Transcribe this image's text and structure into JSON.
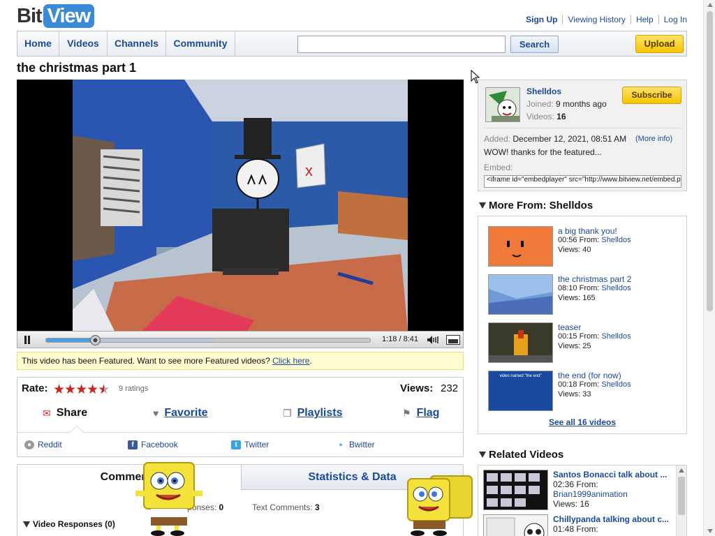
{
  "logo": {
    "part1": "Bit",
    "part2": "View"
  },
  "toplinks": [
    "Sign Up",
    "Viewing History",
    "Help",
    "Log In"
  ],
  "nav": {
    "items": [
      "Home",
      "Videos",
      "Channels",
      "Community"
    ],
    "search_value": "",
    "search_button": "Search",
    "upload_button": "Upload"
  },
  "video": {
    "title": "the christmas part 1",
    "time": "1:18 / 8:41",
    "progress_fraction": 0.15,
    "buffered_fraction": 0.52
  },
  "featured": {
    "text": "This video has been Featured. Want to see more Featured videos?",
    "link": "Click here",
    "end": "."
  },
  "rating": {
    "label": "Rate:",
    "stars": 4.5,
    "count_text": "9 ratings",
    "views_label": "Views:",
    "views": "232"
  },
  "actions": {
    "share": "Share",
    "favorite": "Favorite",
    "playlists": "Playlists",
    "flag": "Flag"
  },
  "social": {
    "reddit": "Reddit",
    "facebook": "Facebook",
    "twitter": "Twitter",
    "bwitter": "Bwitter"
  },
  "tabs": {
    "comments": "Comments",
    "stats": "Statistics & Data",
    "responses_label": "Video Responses:",
    "responses_count": "0",
    "text_comments_label": "Text Comments:",
    "text_comments_count": "3",
    "video_responses_heading": "Video Responses (0)"
  },
  "channel": {
    "name": "Shelldos",
    "joined_label": "Joined:",
    "joined": "9 months ago",
    "videos_label": "Videos:",
    "videos": "16",
    "subscribe": "Subscribe",
    "added_label": "Added:",
    "added": "December 12, 2021, 08:51 AM",
    "more_info": "(More info)",
    "description": "WOW! thanks for the featured...",
    "embed_label": "Embed:",
    "embed_code": "<iframe id=\"embedplayer\" src=\"http://www.bitview.net/embed.php"
  },
  "more_from": {
    "heading": "More From: Shelldos",
    "from_label": "From:",
    "views_label": "Views:",
    "videos": [
      {
        "title": "a big thank you!",
        "duration": "00:56",
        "user": "Shelldos",
        "views": "40"
      },
      {
        "title": "the christmas part 2",
        "duration": "08:10",
        "user": "Shelldos",
        "views": "165"
      },
      {
        "title": "teaser",
        "duration": "00:15",
        "user": "Shelldos",
        "views": "25"
      },
      {
        "title": "the end (for now)",
        "duration": "00:18",
        "user": "Shelldos",
        "views": "33"
      }
    ],
    "see_all": "See all 16 videos",
    "thumb4_text": "video named \"the end\""
  },
  "related": {
    "heading": "Related Videos",
    "from_label": "From:",
    "views_label": "Views:",
    "videos": [
      {
        "title": "Santos Bonacci talk about ...",
        "duration": "02:36",
        "user": "Brian1999animation",
        "views": "16"
      },
      {
        "title": "Chillypanda talking about c...",
        "duration": "01:48",
        "user": "",
        "views": ""
      }
    ]
  },
  "colors": {
    "link": "#1a4a9a",
    "star": "#d42020",
    "button_yellow": "#f6c500",
    "featured_bg": "#fffdd0"
  }
}
